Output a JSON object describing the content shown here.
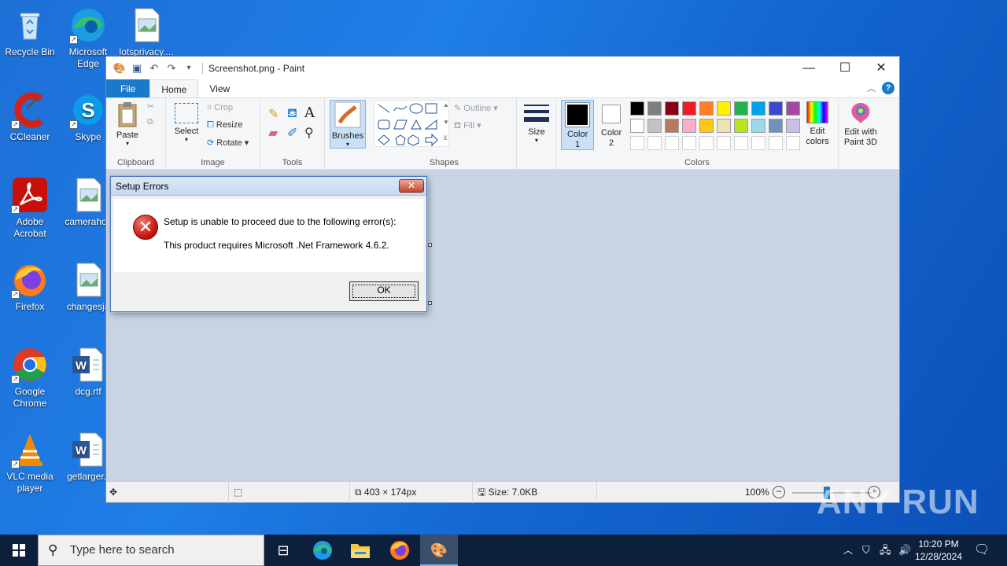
{
  "desktop": {
    "icons": [
      {
        "label": "Recycle Bin"
      },
      {
        "label": "Microsoft Edge"
      },
      {
        "label": "lotsprivacy...."
      },
      {
        "label": "CCleaner"
      },
      {
        "label": "Skype"
      },
      {
        "label": "Adobe Acrobat"
      },
      {
        "label": "camerahos"
      },
      {
        "label": "Firefox"
      },
      {
        "label": "changesja"
      },
      {
        "label": "Google Chrome"
      },
      {
        "label": "dcg.rtf"
      },
      {
        "label": "VLC media player"
      },
      {
        "label": "getlarger.r"
      }
    ]
  },
  "paint": {
    "title": "Screenshot.png - Paint",
    "tabs": [
      "File",
      "Home",
      "View"
    ],
    "clipboard": {
      "paste": "Paste",
      "group": "Clipboard"
    },
    "image": {
      "select": "Select",
      "crop": "Crop",
      "resize": "Resize",
      "rotate": "Rotate",
      "group": "Image"
    },
    "tools": {
      "group": "Tools"
    },
    "brushes": "Brushes",
    "shapes": {
      "outline": "Outline",
      "fill": "Fill",
      "group": "Shapes"
    },
    "size": "Size",
    "color1": "Color 1",
    "color2": "Color 2",
    "colors_group": "Colors",
    "edit_colors": "Edit colors",
    "edit_paint3d": "Edit with Paint 3D",
    "palette_row1": [
      "#000000",
      "#7f7f7f",
      "#880015",
      "#ed1c24",
      "#ff7f27",
      "#fff200",
      "#22b14c",
      "#00a2e8",
      "#3f48cc",
      "#a349a4"
    ],
    "palette_row2": [
      "#ffffff",
      "#c3c3c3",
      "#b97a57",
      "#ffaec9",
      "#ffc90e",
      "#efe4b0",
      "#b5e61d",
      "#99d9ea",
      "#7092be",
      "#c8bfe7"
    ],
    "status": {
      "dimensions": "403 × 174px",
      "size": "Size: 7.0KB",
      "zoom": "100%"
    }
  },
  "dialog": {
    "title": "Setup Errors",
    "message1": "Setup is unable to proceed due to the following error(s):",
    "message2": "This product requires Microsoft .Net Framework 4.6.2.",
    "ok": "OK"
  },
  "taskbar": {
    "search_placeholder": "Type here to search",
    "time": "10:20 PM",
    "date": "12/28/2024"
  },
  "watermark": "ANY RUN"
}
